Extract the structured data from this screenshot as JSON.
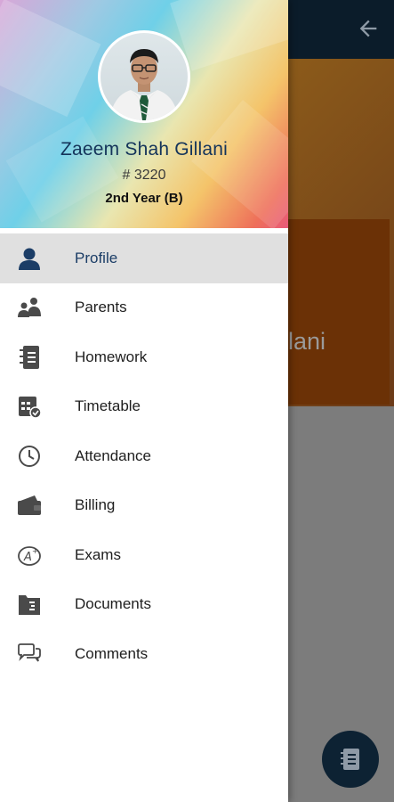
{
  "student": {
    "name": "Zaeem Shah Gillani",
    "id": "# 3220",
    "class": "2nd Year (B)"
  },
  "menu": {
    "items": [
      {
        "label": "Profile",
        "icon": "person-icon"
      },
      {
        "label": "Parents",
        "icon": "parents-icon"
      },
      {
        "label": "Homework",
        "icon": "notebook-icon"
      },
      {
        "label": "Timetable",
        "icon": "timetable-icon"
      },
      {
        "label": "Attendance",
        "icon": "clock-icon"
      },
      {
        "label": "Billing",
        "icon": "wallet-icon"
      },
      {
        "label": "Exams",
        "icon": "exam-icon"
      },
      {
        "label": "Documents",
        "icon": "documents-icon"
      },
      {
        "label": "Comments",
        "icon": "comments-icon"
      }
    ],
    "active_index": 0
  },
  "background": {
    "name_fragment": "lani",
    "back_icon": "arrow-left-icon",
    "fab_icon": "notebook-icon"
  },
  "colors": {
    "name": "#14345a",
    "icon_active": "#1b3d66",
    "icon": "#4a4a4a",
    "active_row": "#e0e0e0"
  }
}
